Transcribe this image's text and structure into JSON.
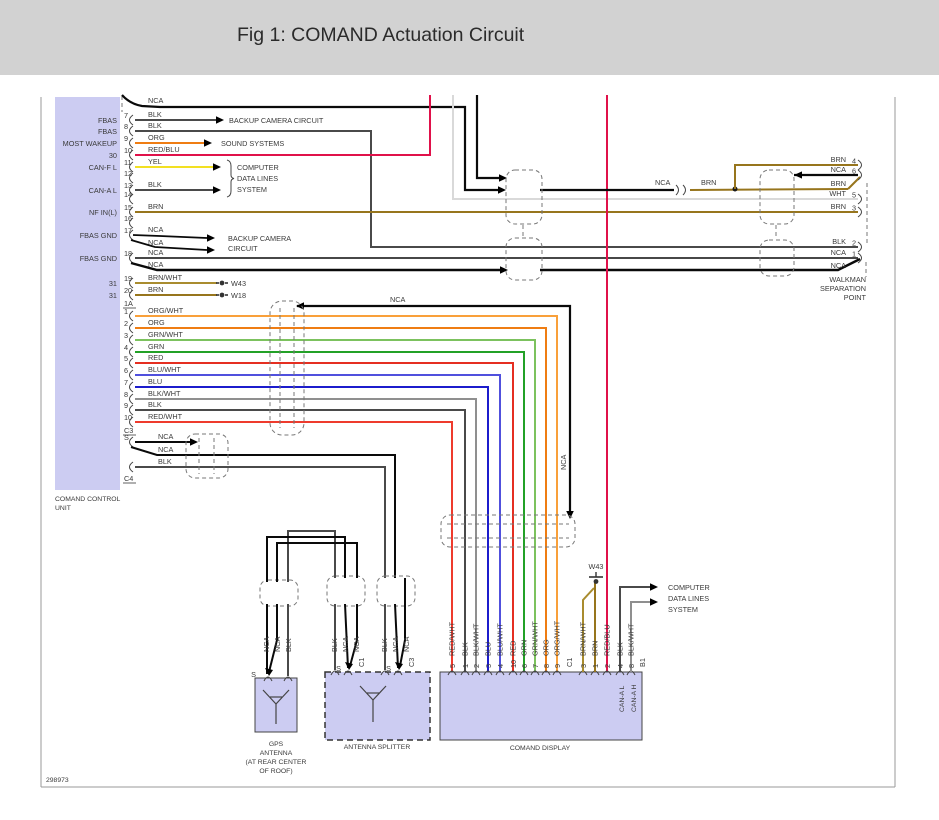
{
  "header": {
    "title": "Fig 1: COMAND Actuation Circuit"
  },
  "footer": {
    "ref": "298973"
  },
  "colors": {
    "BLK": "#4a4a4a",
    "NCA": "#0a0a0a",
    "ORG": "#ef7d13",
    "ORG/WHT": "#f9a03a",
    "RED/BLU": "#e0114a",
    "YEL": "#f2e022",
    "BRN": "#97751d",
    "BRN/WHT": "#a98c2f",
    "GRN": "#23a127",
    "GRN/WHT": "#7cc25e",
    "RED": "#e52f21",
    "RED/WHT": "#ee3b2d",
    "BLU": "#1c1ccc",
    "BLU/WHT": "#5050dd",
    "BLK/WHT": "#8f8f8f",
    "WHT": "#d9d9d9",
    "block_fill": "#ccccf2",
    "header_bg": "#d2d2d2"
  },
  "unit": {
    "label": [
      "COMAND CONTROL",
      "UNIT"
    ],
    "top_wire": "NCA",
    "pins": [
      {
        "num": "7",
        "wire": "BLK",
        "sig": "FBAS"
      },
      {
        "num": "8",
        "wire": "BLK",
        "sig": "FBAS"
      },
      {
        "num": "9",
        "wire": "ORG",
        "sig": "MOST WAKEUP"
      },
      {
        "num": "10",
        "wire": "RED/BLU",
        "sig": "30"
      },
      {
        "num": "11",
        "wire": "YEL",
        "sig": "CAN-F L"
      },
      {
        "num": "12",
        "wire": "",
        "sig": ""
      },
      {
        "num": "13",
        "wire": "BLK",
        "sig": "CAN-A L"
      },
      {
        "num": "14",
        "wire": "",
        "sig": ""
      },
      {
        "num": "15",
        "wire": "BRN",
        "sig": "NF IN(L)"
      },
      {
        "num": "16",
        "wire": "",
        "sig": ""
      },
      {
        "num": "17",
        "wire": "NCA",
        "sig": "FBAS GND"
      },
      {
        "num": "18",
        "wire": "NCA",
        "sig": "FBAS GND"
      },
      {
        "num": "19",
        "wire": "BRN/WHT",
        "sig": "31"
      },
      {
        "num": "20",
        "wire": "BRN",
        "sig": "31"
      }
    ],
    "pin17_extra": "NCA",
    "pin18_extra": "NCA",
    "conn_1a": "1A",
    "conn_c3": "C3",
    "conn_c4": "C4",
    "pin_s": "S",
    "c1_pins": [
      {
        "num": "1",
        "wire": "ORG/WHT"
      },
      {
        "num": "2",
        "wire": "ORG"
      },
      {
        "num": "3",
        "wire": "GRN/WHT"
      },
      {
        "num": "4",
        "wire": "GRN"
      },
      {
        "num": "5",
        "wire": "RED"
      },
      {
        "num": "6",
        "wire": "BLU/WHT"
      },
      {
        "num": "7",
        "wire": "BLU"
      },
      {
        "num": "8",
        "wire": "BLK/WHT"
      },
      {
        "num": "9",
        "wire": "BLK"
      },
      {
        "num": "10",
        "wire": "RED/WHT"
      }
    ],
    "s_wires": [
      "NCA",
      "NCA",
      "BLK"
    ]
  },
  "targets": {
    "backup1": "BACKUP CAMERA CIRCUIT",
    "sound": "SOUND SYSTEMS",
    "computer1": [
      "COMPUTER",
      "DATA LINES",
      "SYSTEM"
    ],
    "backup2": [
      "BACKUP CAMERA",
      "CIRCUIT"
    ],
    "computer2": [
      "COMPUTER",
      "DATA LINES",
      "SYSTEM"
    ]
  },
  "grounds": {
    "w43": "W43",
    "w18": "W18",
    "w43_display": "W43"
  },
  "labels": {
    "splice_nca": "NCA",
    "splice_brn": "BRN",
    "mid_nca": "NCA",
    "mid_nca_vert": "NCA"
  },
  "right": {
    "rows": [
      {
        "wire": "BRN",
        "pin": "4"
      },
      {
        "wire": "NCA",
        "pin": "6"
      },
      {
        "wire": "BRN",
        "pin": ""
      },
      {
        "wire": "WHT",
        "pin": "5"
      },
      {
        "wire": "BRN",
        "pin": "3"
      },
      {
        "wire": "BLK",
        "pin": "2"
      },
      {
        "wire": "NCA",
        "pin": "1"
      },
      {
        "wire": "NCA",
        "pin": ""
      }
    ],
    "note": [
      "WALKMAN",
      "SEPARATION",
      "POINT"
    ]
  },
  "display": {
    "label": "COMAND DISPLAY",
    "c1_label": "C1",
    "b1_label": "B1",
    "c1_pins": [
      {
        "num": "5",
        "wire": "RED/WHT"
      },
      {
        "num": "1",
        "wire": "BLK"
      },
      {
        "num": "2",
        "wire": "BLK/WHT"
      },
      {
        "num": "3",
        "wire": "BLU"
      },
      {
        "num": "4",
        "wire": "BLU/WHT"
      },
      {
        "num": "10",
        "wire": "RED"
      },
      {
        "num": "6",
        "wire": "GRN"
      },
      {
        "num": "7",
        "wire": "GRN/WHT"
      },
      {
        "num": "8",
        "wire": "ORG"
      },
      {
        "num": "9",
        "wire": "ORG/WHT"
      }
    ],
    "b1_pins": [
      {
        "num": "3",
        "wire": "BRN/WHT"
      },
      {
        "num": "1",
        "wire": "BRN"
      },
      {
        "num": "2",
        "wire": "RED/BLU"
      },
      {
        "num": "4",
        "wire": "BLK"
      },
      {
        "num": "8",
        "wire": "BLK/WHT"
      }
    ],
    "internal": [
      "CAN-A L",
      "CAN-A H"
    ]
  },
  "gps": {
    "pin": "S",
    "wires": [
      "NCA",
      "NCA",
      "BLK"
    ],
    "label": [
      "GPS",
      "ANTENNA",
      "(AT REAR CENTER",
      "OF ROOF)"
    ]
  },
  "splitter": {
    "label": "ANTENNA SPLITTER",
    "a": {
      "pin": "S",
      "conn": "C1",
      "wires": [
        "BLK",
        "NCA",
        "NCA"
      ]
    },
    "b": {
      "pin": "S",
      "conn": "C3",
      "wires": [
        "BLK",
        "NCA",
        "NCA"
      ]
    }
  }
}
